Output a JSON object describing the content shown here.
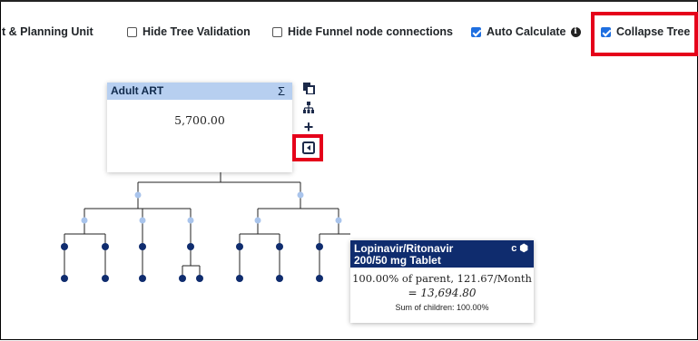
{
  "toolbar": {
    "planning_unit_label": "t & Planning Unit",
    "hide_tree_validation": {
      "label": "Hide Tree Validation",
      "checked": false
    },
    "hide_funnel": {
      "label": "Hide Funnel node connections",
      "checked": false
    },
    "auto_calculate": {
      "label": "Auto Calculate",
      "checked": true
    },
    "collapse_tree": {
      "label": "Collapse Tree",
      "checked": true
    }
  },
  "root_node": {
    "title": "Adult ART",
    "sigma": "Σ",
    "value": "5,700.00"
  },
  "side_icons": [
    "copy-icon",
    "sitemap-icon",
    "plus-icon",
    "collapse-icon"
  ],
  "tooltip": {
    "title_line1": "Lopinavir/Ritonavir",
    "title_line2": "200/50 mg Tablet",
    "flags": "c ⬢",
    "line1": "100.00% of parent, 121.67/Month",
    "line2": "= 13,694.80",
    "line3": "Sum of children: 100.00%"
  },
  "colors": {
    "node_header": "#b7cff0",
    "tooltip_header": "#0f2c6e",
    "highlight": "#e5001a",
    "checkbox": "#1f6fe0",
    "tree_dot_light": "#a9c4ec",
    "tree_dot_dark": "#0f2c6e"
  }
}
